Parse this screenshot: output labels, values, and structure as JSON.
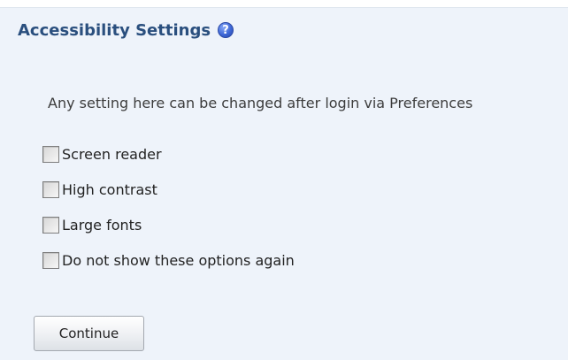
{
  "header": {
    "title": "Accessibility Settings",
    "help_icon": "help-icon",
    "help_glyph": "?"
  },
  "intro_text": "Any setting here can be changed after login via Preferences",
  "options": [
    {
      "label": "Screen reader",
      "checked": false
    },
    {
      "label": "High contrast",
      "checked": false
    },
    {
      "label": "Large fonts",
      "checked": false
    },
    {
      "label": "Do not show these options again",
      "checked": false
    }
  ],
  "continue_label": "Continue",
  "colors": {
    "panel_background": "#eef3fa",
    "title": "#2a4f7e",
    "help_icon": "#3e67d6"
  }
}
